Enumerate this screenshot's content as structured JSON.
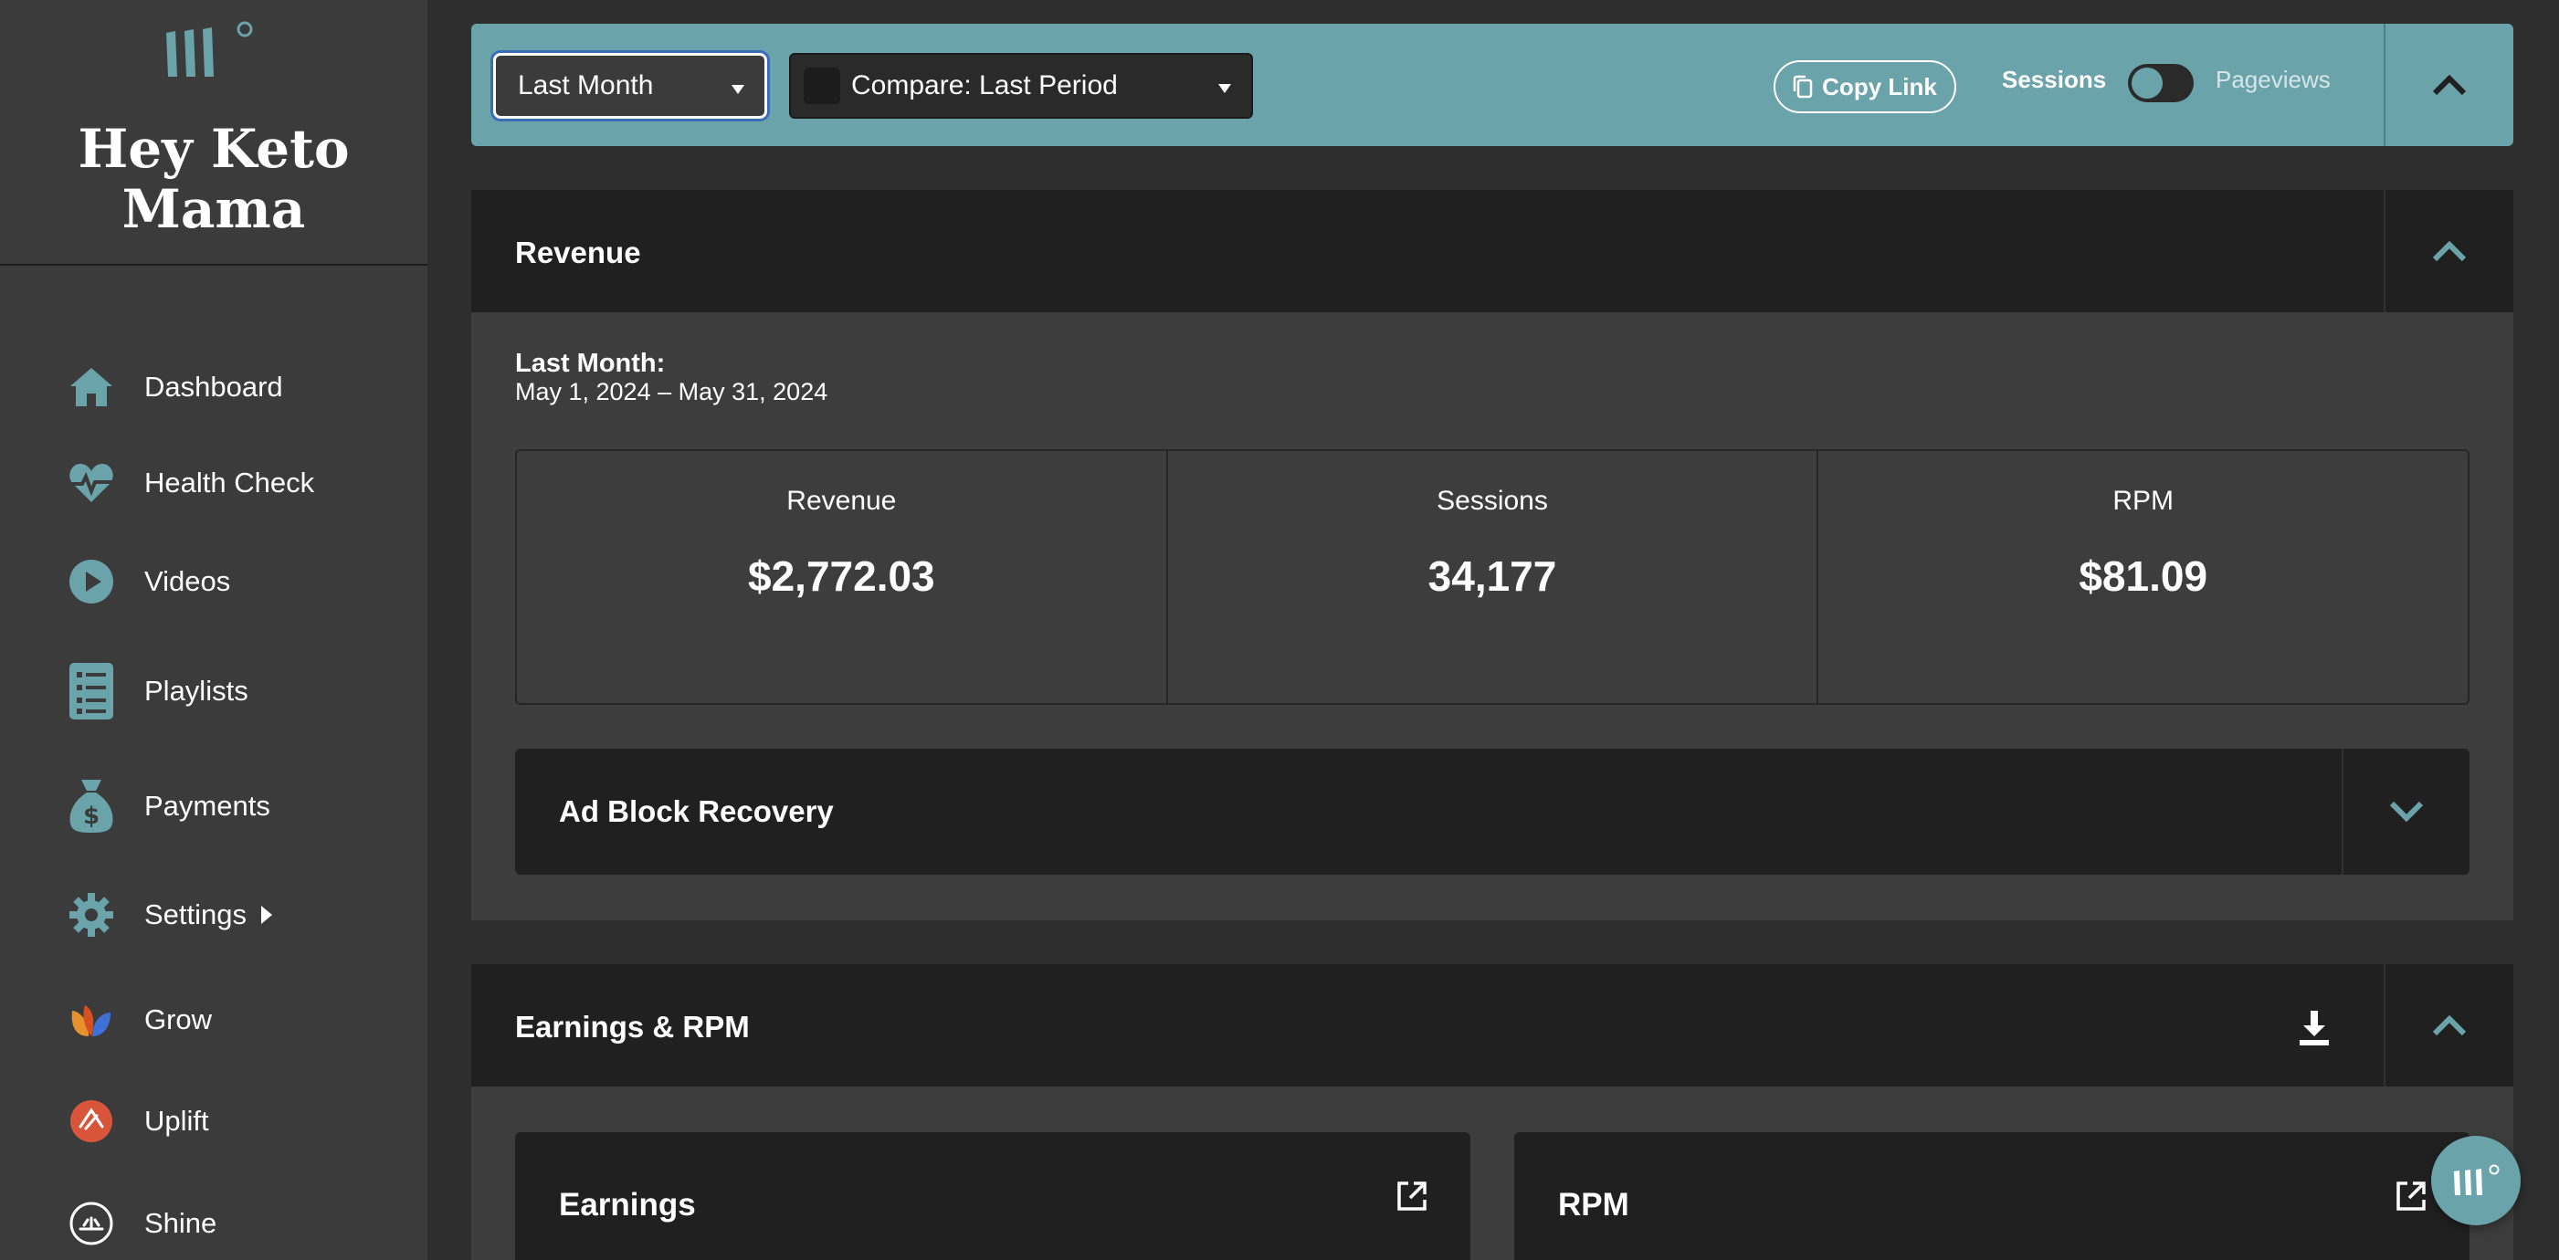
{
  "sidebar": {
    "logo_icon": "mediavine-logo-icon",
    "site_name": "Hey Keto Mama",
    "items": [
      {
        "label": "Dashboard",
        "icon": "home-icon"
      },
      {
        "label": "Health Check",
        "icon": "heartbeat-icon"
      },
      {
        "label": "Videos",
        "icon": "play-circle-icon"
      },
      {
        "label": "Playlists",
        "icon": "checklist-icon"
      },
      {
        "label": "Payments",
        "icon": "money-bag-icon"
      },
      {
        "label": "Settings",
        "icon": "gear-icon"
      },
      {
        "label": "Grow",
        "icon": "grow-logo-icon"
      },
      {
        "label": "Uplift",
        "icon": "uplift-logo-icon"
      },
      {
        "label": "Shine",
        "icon": "shine-logo-icon"
      }
    ]
  },
  "toolbar": {
    "period_select": "Last Month",
    "compare_select": "Compare: Last Period",
    "copy_link": "Copy Link",
    "toggle_left": "Sessions",
    "toggle_right": "Pageviews"
  },
  "revenue": {
    "title": "Revenue",
    "period_title": "Last Month:",
    "period_range": "May 1, 2024 – May 31, 2024",
    "stats": [
      {
        "label": "Revenue",
        "value": "$2,772.03"
      },
      {
        "label": "Sessions",
        "value": "34,177"
      },
      {
        "label": "RPM",
        "value": "$81.09"
      }
    ],
    "ad_block_title": "Ad Block Recovery"
  },
  "earnings": {
    "title": "Earnings & RPM",
    "cards": [
      {
        "title": "Earnings"
      },
      {
        "title": "RPM"
      }
    ]
  },
  "colors": {
    "accent": "#6ba3ab",
    "sidebar_bg": "#3b3b3b",
    "panel_header": "#202020",
    "panel_body": "#3d3d3d"
  }
}
